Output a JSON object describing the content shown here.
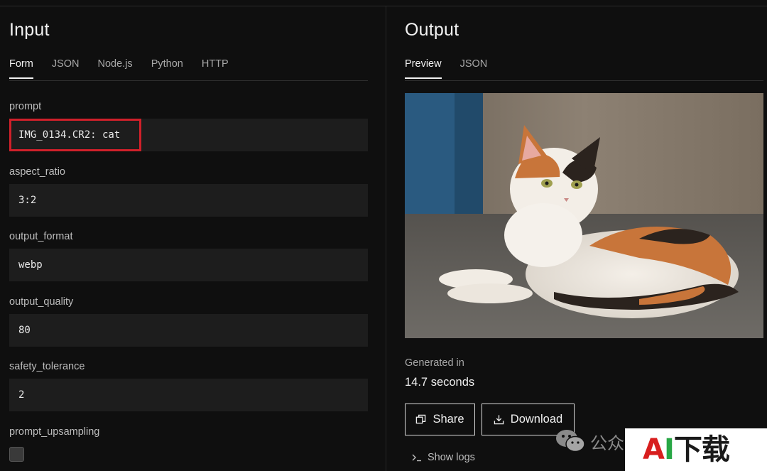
{
  "input": {
    "title": "Input",
    "tabs": [
      {
        "label": "Form",
        "active": true
      },
      {
        "label": "JSON",
        "active": false
      },
      {
        "label": "Node.js",
        "active": false
      },
      {
        "label": "Python",
        "active": false
      },
      {
        "label": "HTTP",
        "active": false
      }
    ],
    "fields": {
      "prompt": {
        "label": "prompt",
        "value": "IMG_0134.CR2: cat"
      },
      "aspect_ratio": {
        "label": "aspect_ratio",
        "value": "3:2"
      },
      "output_format": {
        "label": "output_format",
        "value": "webp"
      },
      "output_quality": {
        "label": "output_quality",
        "value": "80"
      },
      "safety_tolerance": {
        "label": "safety_tolerance",
        "value": "2"
      },
      "prompt_upsampling": {
        "label": "prompt_upsampling",
        "checked": false
      }
    },
    "highlight_color": "#d0202a"
  },
  "output": {
    "title": "Output",
    "tabs": [
      {
        "label": "Preview",
        "active": true
      },
      {
        "label": "JSON",
        "active": false
      }
    ],
    "generated_label": "Generated in",
    "generated_value": "14.7 seconds",
    "share_label": "Share",
    "download_label": "Download",
    "logs_label": "Show logs"
  },
  "watermark": {
    "text": "公众",
    "brand_a": "A",
    "brand_i": "I",
    "brand_rest": "下载"
  }
}
